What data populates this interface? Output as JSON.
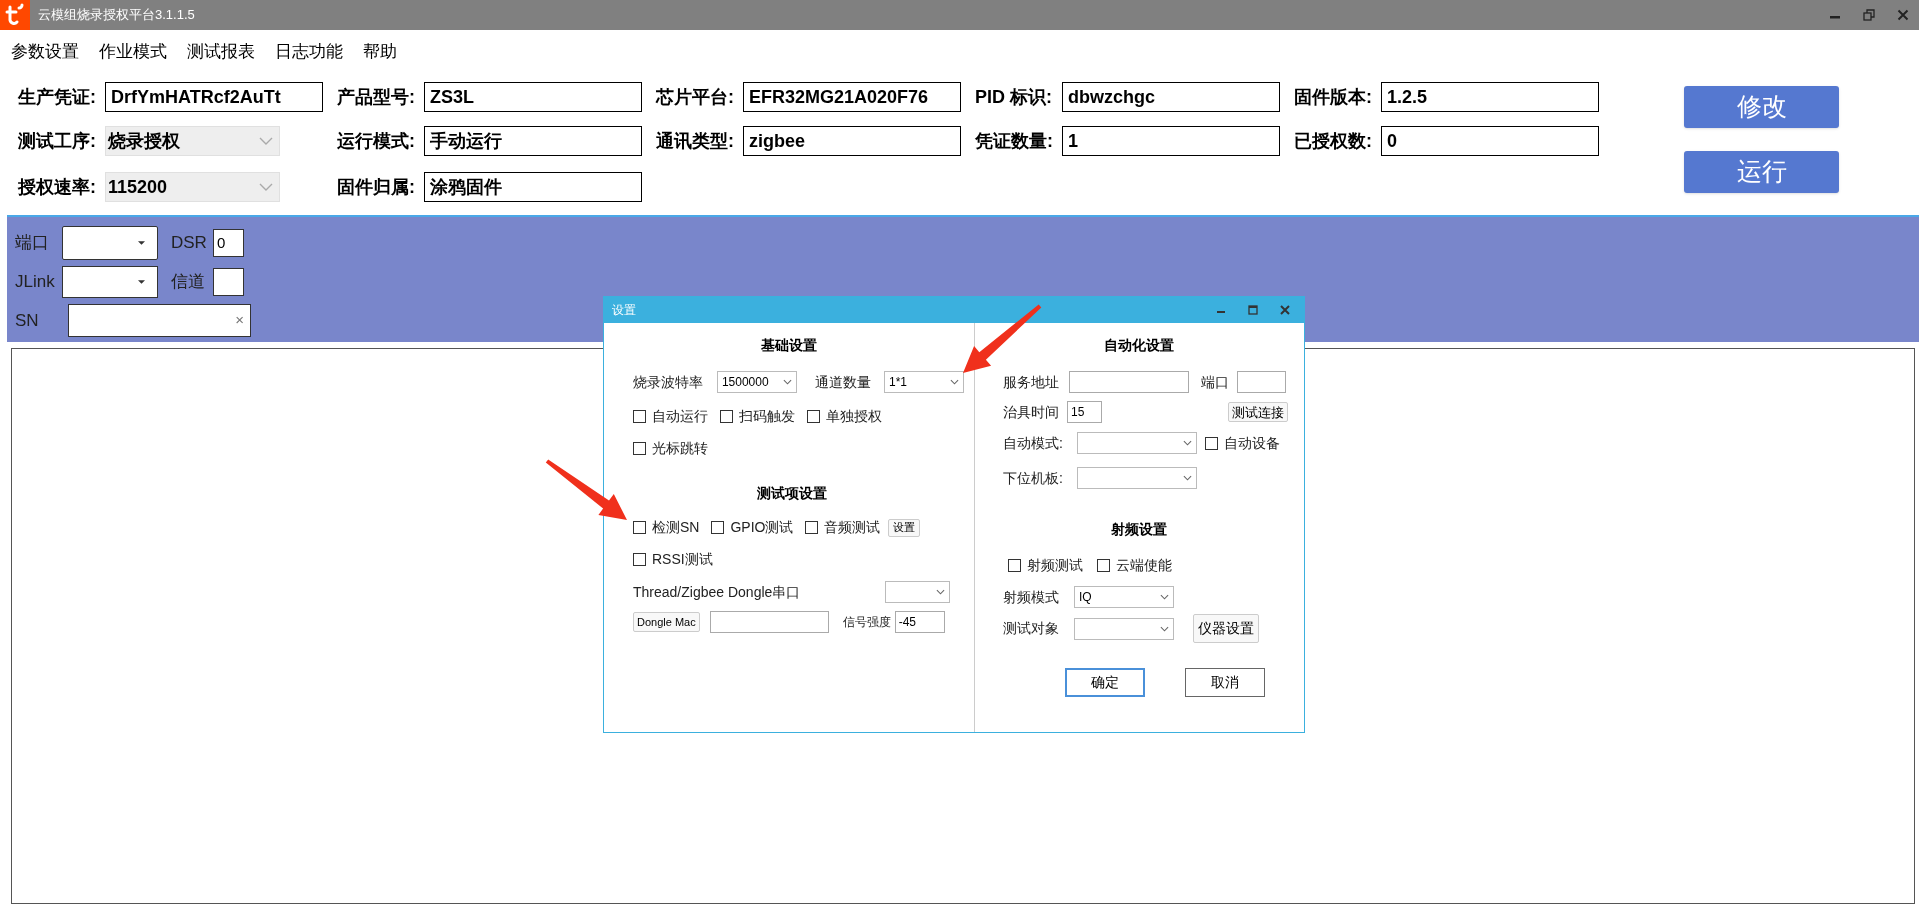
{
  "window": {
    "title": "云模组烧录授权平台3.1.1.5"
  },
  "menu": [
    "参数设置",
    "作业模式",
    "测试报表",
    "日志功能",
    "帮助"
  ],
  "form_rows": [
    [
      {
        "label": "生产凭证:",
        "value": "DrfYmHATRcf2AuTt",
        "kind": "text"
      },
      {
        "label": "产品型号:",
        "value": "ZS3L",
        "kind": "text"
      },
      {
        "label": "芯片平台:",
        "value": "EFR32MG21A020F76",
        "kind": "text"
      },
      {
        "label": "PID 标识:",
        "value": "dbwzchgc",
        "kind": "text"
      },
      {
        "label": "固件版本:",
        "value": "1.2.5",
        "kind": "text"
      }
    ],
    [
      {
        "label": "测试工序:",
        "value": "烧录授权",
        "kind": "dropdown"
      },
      {
        "label": "运行模式:",
        "value": "手动运行",
        "kind": "text"
      },
      {
        "label": "通讯类型:",
        "value": "zigbee",
        "kind": "text"
      },
      {
        "label": "凭证数量:",
        "value": "1",
        "kind": "text"
      },
      {
        "label": "已授权数:",
        "value": "0",
        "kind": "text"
      }
    ],
    [
      {
        "label": "授权速率:",
        "value": "115200",
        "kind": "dropdown"
      },
      {
        "label": "固件归属:",
        "value": "涂鸦固件",
        "kind": "text"
      }
    ]
  ],
  "action_buttons": [
    "修改",
    "运行"
  ],
  "connection_panel": {
    "port_label": "端口",
    "dsr_label": "DSR",
    "dsr_value": "0",
    "jlink_label": "JLink",
    "channel_label": "信道",
    "sn_label": "SN",
    "sn_clear": "×"
  },
  "settings_dialog": {
    "title": "设置",
    "basic": {
      "heading": "基础设置",
      "baud_label": "烧录波特率",
      "baud_value": "1500000",
      "channels_label": "通道数量",
      "channels_value": "1*1",
      "options": [
        {
          "label": "自动运行",
          "checked": false
        },
        {
          "label": "扫码触发",
          "checked": false
        },
        {
          "label": "单独授权",
          "checked": false
        },
        {
          "label": "光标跳转",
          "checked": false
        }
      ]
    },
    "tests": {
      "heading": "测试项设置",
      "options": [
        {
          "label": "检测SN",
          "checked": false
        },
        {
          "label": "GPIO测试",
          "checked": false
        },
        {
          "label": "音频测试",
          "checked": false
        },
        {
          "label": "RSSI测试",
          "checked": false
        }
      ],
      "audio_settings_button": "设置",
      "dongle_port_label": "Thread/Zigbee Dongle串口",
      "dongle_mac_button": "Dongle Mac",
      "signal_label": "信号强度",
      "signal_value": "-45"
    },
    "automation": {
      "heading": "自动化设置",
      "server_label": "服务地址",
      "port_label": "端口",
      "fixture_time_label": "治具时间",
      "fixture_time_value": "15",
      "test_connection_button": "测试连接",
      "auto_mode_label": "自动模式:",
      "auto_device": {
        "label": "自动设备",
        "checked": false
      },
      "board_label": "下位机板:"
    },
    "rf": {
      "heading": "射频设置",
      "options": [
        {
          "label": "射频测试",
          "checked": false
        },
        {
          "label": "云端使能",
          "checked": false
        }
      ],
      "mode_label": "射频模式",
      "mode_value": "IQ",
      "target_label": "测试对象",
      "instrument_button": "仪器设置"
    },
    "ok_button": "确定",
    "cancel_button": "取消"
  }
}
